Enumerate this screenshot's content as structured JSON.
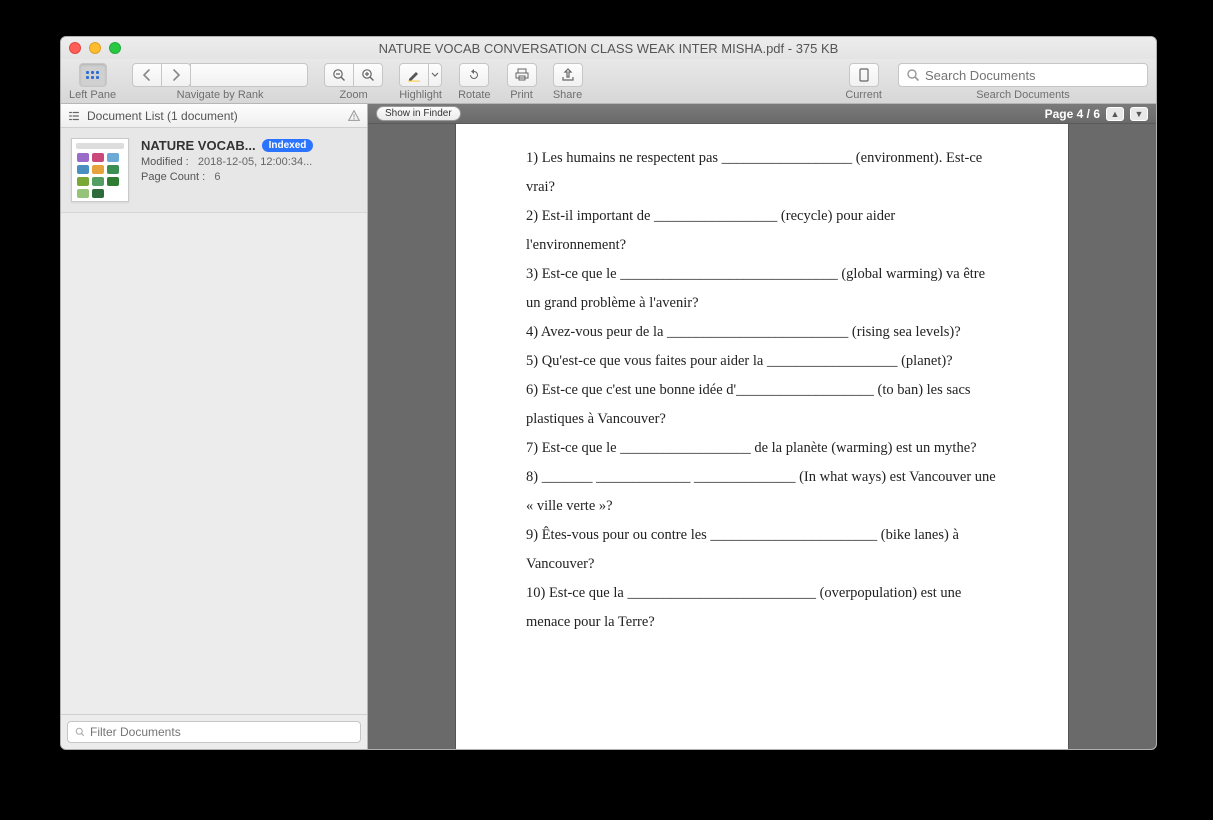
{
  "window": {
    "title": "NATURE VOCAB CONVERSATION CLASS WEAK INTER MISHA.pdf - 375 KB"
  },
  "toolbar": {
    "left_pane": "Left Pane",
    "navigate": "Navigate by Rank",
    "zoom": "Zoom",
    "highlight": "Highlight",
    "rotate": "Rotate",
    "print": "Print",
    "share": "Share",
    "current": "Current",
    "search_docs": "Search Documents",
    "search_placeholder": "Search Documents"
  },
  "left": {
    "header": "Document List (1 document)",
    "filter_placeholder": "Filter Documents",
    "doc": {
      "title": "NATURE VOCAB...",
      "badge": "Indexed",
      "modified_label": "Modified :",
      "modified_value": "2018-12-05, 12:00:34...",
      "pagecount_label": "Page Count :",
      "pagecount_value": "6"
    }
  },
  "viewer": {
    "show_in_finder": "Show in Finder",
    "page_indicator": "Page 4 / 6"
  },
  "document": {
    "lines": [
      "1) Les humains ne respectent pas __________________ (environment). Est-ce vrai?",
      "2) Est-il important de _________________ (recycle) pour aider l'environnement?",
      "3) Est-ce que le ______________________________ (global warming) va être un grand problème à l'avenir?",
      "4) Avez-vous peur de la _________________________ (rising sea levels)?",
      "5) Qu'est-ce que vous faites pour aider la __________________ (planet)?",
      "6) Est-ce que c'est une bonne idée d'___________________ (to ban) les sacs plastiques à Vancouver?",
      "7) Est-ce que le __________________ de la planète (warming) est un mythe?",
      "8) _______ _____________ ______________ (In what ways) est Vancouver une « ville verte »?",
      "9) Êtes-vous pour ou contre les _______________________ (bike lanes) à Vancouver?",
      "10) Est-ce que la __________________________ (overpopulation) est une menace pour la Terre?"
    ]
  }
}
